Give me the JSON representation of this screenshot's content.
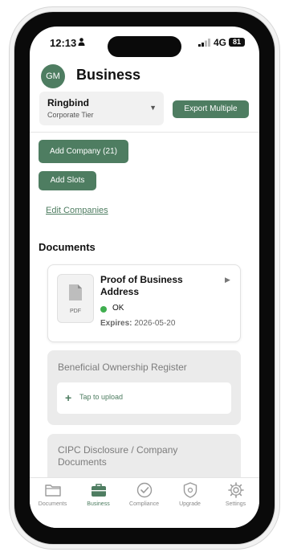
{
  "status_bar": {
    "time": "12:13",
    "network": "4G",
    "battery": "81"
  },
  "header": {
    "avatar_initials": "GM",
    "title": "Business"
  },
  "company_selector": {
    "name": "Ringbind",
    "tier": "Corporate Tier"
  },
  "actions": {
    "export_multiple": "Export Multiple",
    "add_company": "Add Company (21)",
    "add_slots": "Add Slots",
    "edit_companies": "Edit Companies"
  },
  "documents": {
    "section_title": "Documents",
    "items": [
      {
        "title": "Proof of Business Address",
        "file_type": "PDF",
        "status": "OK",
        "expires_label": "Expires:",
        "expires_date": "2026-05-20"
      },
      {
        "title": "Beneficial Ownership Register",
        "upload_label": "Tap to upload"
      },
      {
        "title": "CIPC Disclosure / Company Documents"
      }
    ]
  },
  "tab_bar": {
    "tabs": [
      {
        "label": "Documents",
        "icon": "folder-icon"
      },
      {
        "label": "Business",
        "icon": "briefcase-icon"
      },
      {
        "label": "Compliance",
        "icon": "check-circle-icon"
      },
      {
        "label": "Upgrade",
        "icon": "shield-icon"
      },
      {
        "label": "Settings",
        "icon": "gear-icon"
      }
    ],
    "active": "Business"
  },
  "colors": {
    "accent": "#4e7d61",
    "ok": "#3fae4f"
  }
}
